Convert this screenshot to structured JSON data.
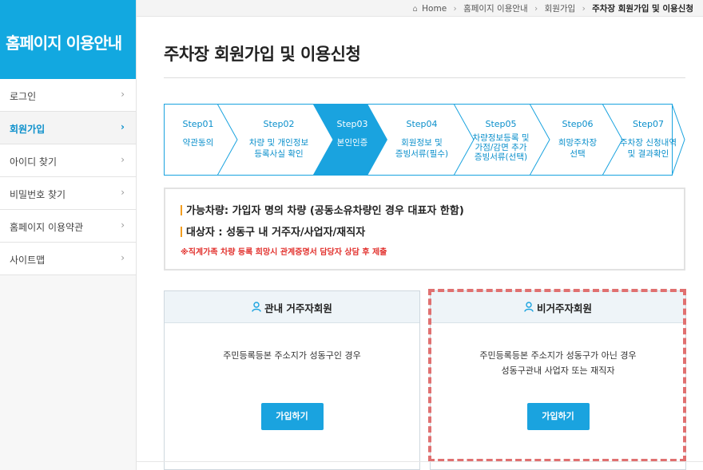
{
  "sidebar": {
    "title": "홈페이지 이용안내",
    "items": [
      {
        "label": "로그인",
        "active": false
      },
      {
        "label": "회원가입",
        "active": true
      },
      {
        "label": "아이디 찾기",
        "active": false
      },
      {
        "label": "비밀번호 찾기",
        "active": false
      },
      {
        "label": "홈페이지 이용약관",
        "active": false
      },
      {
        "label": "사이트맵",
        "active": false
      }
    ],
    "chevron": "›"
  },
  "breadcrumb": {
    "home": "Home",
    "items": [
      "홈페이지 이용안내",
      "회원가입"
    ],
    "current": "주차장 회원가입 및 이용신청",
    "separator": "›"
  },
  "page_title": "주차장 회원가입 및 이용신청",
  "steps": [
    {
      "num": "Step01",
      "label": "약관동의"
    },
    {
      "num": "Step02",
      "label": "차량 및 개인정보\n등록사실 확인"
    },
    {
      "num": "Step03",
      "label": "본인인증",
      "active": true
    },
    {
      "num": "Step04",
      "label": "회원정보 및\n증빙서류(필수)"
    },
    {
      "num": "Step05",
      "label": "차량정보등록 및\n가점/감면 추가\n증빙서류(선택)"
    },
    {
      "num": "Step06",
      "label": "희망주차장\n선택"
    },
    {
      "num": "Step07",
      "label": "주차장 신청내역\n및 결과확인"
    }
  ],
  "info": {
    "line1": "가능차량: 가입자 명의 차량 (공동소유차량인 경우 대표자 한함)",
    "line2": "대상자 : 성동구 내 거주자/사업자/재직자",
    "note": "※직계가족 차량 등록 희망시 관계증명서 담당자 상담 후 제출"
  },
  "cards": {
    "resident": {
      "title": "관내 거주자회원",
      "desc": "주민등록등본 주소지가 성동구인 경우",
      "button": "가입하기"
    },
    "nonresident": {
      "title": "비거주자회원",
      "desc": "주민등록등본 주소지가 성동구가 아닌 경우\n성동구관내 사업자 또는 재직자",
      "button": "가입하기"
    }
  },
  "colors": {
    "accent": "#12a8e0",
    "step_active": "#1aa3df",
    "warning": "#e2332f",
    "highlight": "#e07070"
  },
  "icons": {
    "home": "home-icon",
    "person": "person-icon"
  }
}
